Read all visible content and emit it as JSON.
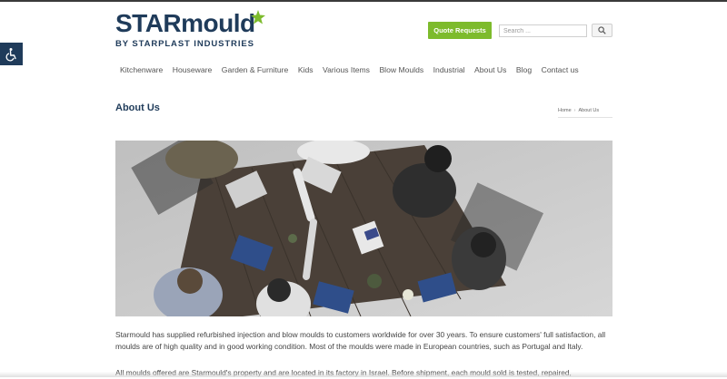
{
  "brand": {
    "logo_main": "STARmould",
    "logo_sub": "BY STARPLAST INDUSTRIES",
    "accent_green": "#7dbb2c",
    "brand_navy": "#1f3b5a"
  },
  "header": {
    "quote_button_label": "Quote Requests",
    "search_placeholder": "Search ...",
    "search_button_icon": "magnifier-icon",
    "accessibility_icon": "wheelchair-icon"
  },
  "nav": {
    "items": [
      "Kitchenware",
      "Houseware",
      "Garden & Furniture",
      "Kids",
      "Various Items",
      "Blow Moulds",
      "Industrial",
      "About Us",
      "Blog",
      "Contact us"
    ]
  },
  "page": {
    "title": "About Us",
    "breadcrumb": [
      "Home",
      "About Us"
    ],
    "hero_image": "team meeting at wooden table with laptops and handshake",
    "paragraphs": [
      "Starmould has supplied refurbished injection and blow moulds to customers worldwide for over 30 years. To ensure customers' full satisfaction, all moulds are of high quality and in good working condition. Most of the moulds were made in European countries, such as Portugal and Italy.",
      "All moulds offered are Starmould's property and are located in its factory in Israel. Before shipment, each mould sold is tested, repaired,"
    ]
  }
}
